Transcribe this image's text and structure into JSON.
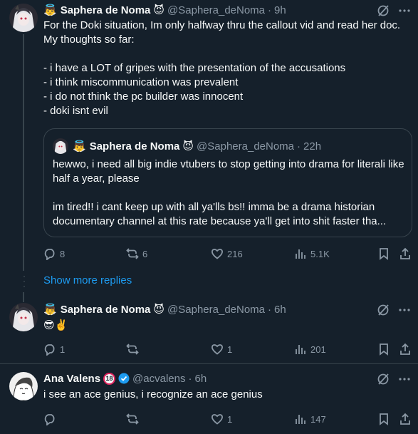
{
  "posts": [
    {
      "emoji_prefix": "👼",
      "display_name": "Saphera de Noma",
      "name_emoji": "😈",
      "handle": "@Saphera_deNoma",
      "dot": "·",
      "time": "9h",
      "text": "For the Doki situation, Im only halfway thru the callout vid and read her doc.\nMy thoughts so far:\n\n- i have a LOT of gripes with the presentation of the accusations\n- i think miscommunication was prevalent\n- i do not think the pc builder was innocent\n- doki isnt evil",
      "quote": {
        "emoji_prefix": "👼",
        "display_name": "Saphera de Noma",
        "name_emoji": "😈",
        "handle": "@Saphera_deNoma",
        "dot": "·",
        "time": "22h",
        "text": "hewwo, i need all big indie vtubers to stop getting into drama for literali like half a year, please\n\nim tired!! i cant keep up with all ya'lls bs!! imma be a drama historian documentary channel at this rate because ya'll get into shit faster tha..."
      },
      "replies": "8",
      "reposts": "6",
      "likes": "216",
      "views": "5.1K"
    },
    {
      "emoji_prefix": "👼",
      "display_name": "Saphera de Noma",
      "name_emoji": "😈",
      "handle": "@Saphera_deNoma",
      "dot": "·",
      "time": "6h",
      "text": "😎✌️",
      "replies": "1",
      "reposts": "",
      "likes": "1",
      "views": "201"
    },
    {
      "display_name": "Ana Valens",
      "badge": "18",
      "handle": "@acvalens",
      "dot": "·",
      "time": "6h",
      "text": "i see an ace genius, i recognize an ace genius",
      "replies": "",
      "reposts": "",
      "likes": "1",
      "views": "147"
    }
  ],
  "show_more_replies": "Show more replies",
  "colors": {
    "background": "#15202b",
    "text": "#f7f9f9",
    "muted": "#8b98a5",
    "accent": "#1d9bf0",
    "border": "#38444d"
  }
}
